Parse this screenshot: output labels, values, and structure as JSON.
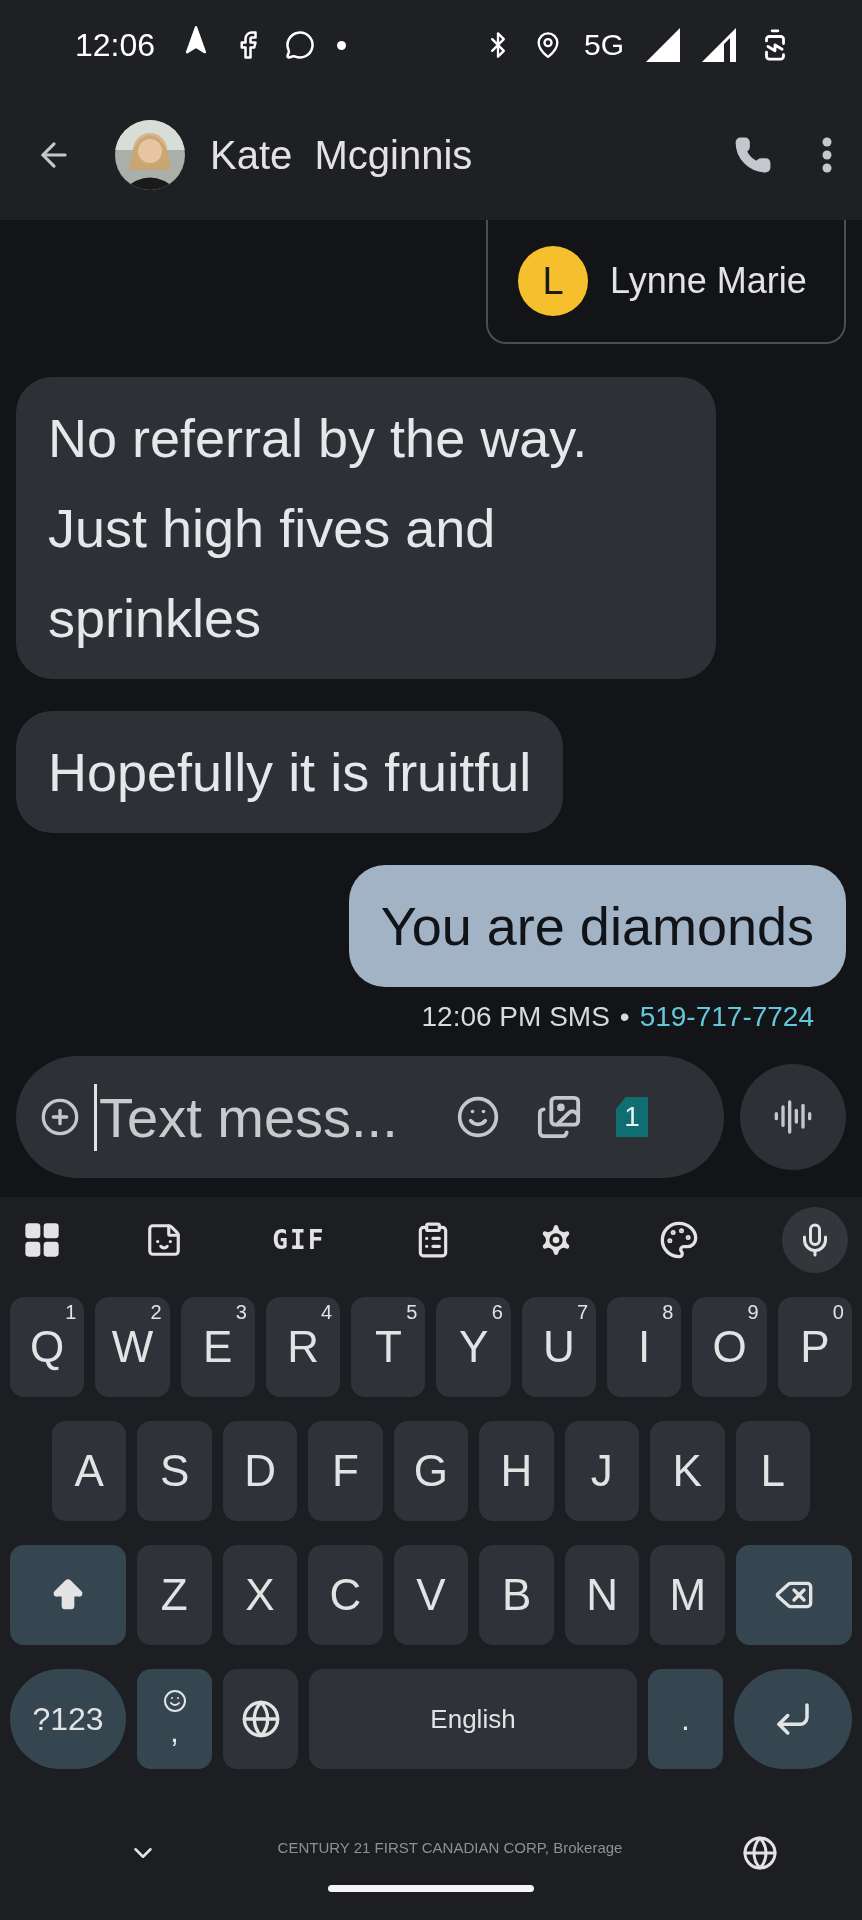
{
  "status_bar": {
    "time": "12:06",
    "network": "5G"
  },
  "header": {
    "contact_name": "Kate  Mcginnis"
  },
  "contact_chip": {
    "initial": "L",
    "name": "Lynne Marie",
    "color": "#f6c02c"
  },
  "messages": [
    {
      "kind": "received",
      "text": "No referral by the way. Just high fives and sprinkles"
    },
    {
      "kind": "received",
      "text": "Hopefully it is fruitful"
    },
    {
      "kind": "sent",
      "text": "You are diamonds"
    }
  ],
  "message_meta": {
    "time": "12:06 PM SMS",
    "separator": "•",
    "number": "519-717-7724"
  },
  "compose": {
    "placeholder": "Text mess...",
    "sim_badge": "1"
  },
  "keyboard_toolbar": {
    "gif_label": "GIF"
  },
  "keyboard_rows": [
    [
      {
        "label": "Q",
        "hint": "1"
      },
      {
        "label": "W",
        "hint": "2"
      },
      {
        "label": "E",
        "hint": "3"
      },
      {
        "label": "R",
        "hint": "4"
      },
      {
        "label": "T",
        "hint": "5"
      },
      {
        "label": "Y",
        "hint": "6"
      },
      {
        "label": "U",
        "hint": "7"
      },
      {
        "label": "I",
        "hint": "8"
      },
      {
        "label": "O",
        "hint": "9"
      },
      {
        "label": "P",
        "hint": "0"
      }
    ],
    [
      {
        "label": "A"
      },
      {
        "label": "S"
      },
      {
        "label": "D"
      },
      {
        "label": "F"
      },
      {
        "label": "G"
      },
      {
        "label": "H"
      },
      {
        "label": "J"
      },
      {
        "label": "K"
      },
      {
        "label": "L"
      }
    ],
    [
      {
        "kind": "shift"
      },
      {
        "label": "Z"
      },
      {
        "label": "X"
      },
      {
        "label": "C"
      },
      {
        "label": "V"
      },
      {
        "label": "B"
      },
      {
        "label": "N"
      },
      {
        "label": "M"
      },
      {
        "kind": "backspace"
      }
    ],
    [
      {
        "kind": "symbols",
        "label": "?123"
      },
      {
        "kind": "comma",
        "label": ","
      },
      {
        "kind": "globe"
      },
      {
        "kind": "space",
        "label": "English"
      },
      {
        "kind": "period",
        "label": "."
      },
      {
        "kind": "enter"
      }
    ]
  ],
  "keyboard_footer": {
    "brand": "CENTURY 21 FIRST CANADIAN CORP, Brokerage"
  }
}
